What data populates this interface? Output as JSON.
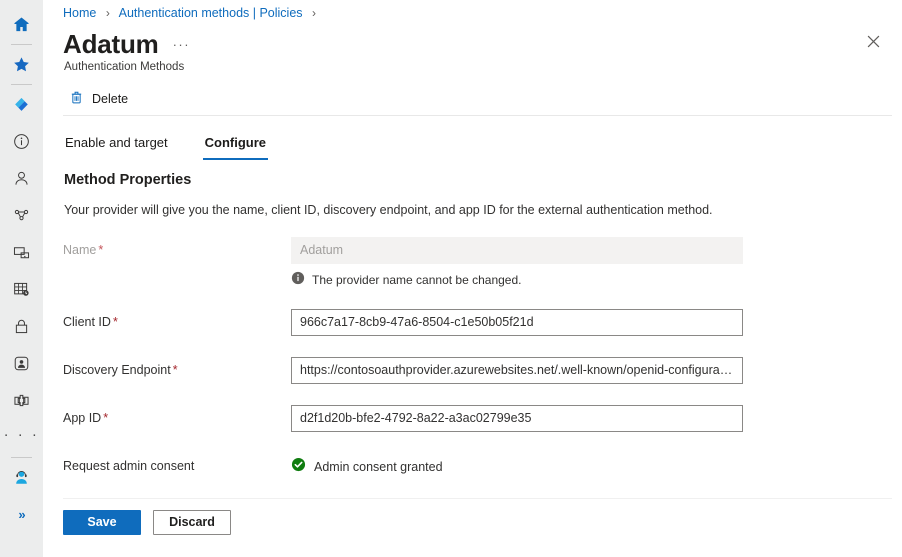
{
  "sidebar": {
    "items": [
      {
        "icon": "home-icon",
        "name": "home"
      },
      {
        "icon": "favorites-star-icon",
        "name": "favorites"
      },
      {
        "icon": "entra-diamond-icon",
        "name": "microsoft-entra"
      },
      {
        "icon": "info-circle-icon",
        "name": "overview-info"
      },
      {
        "icon": "user-person-icon",
        "name": "users"
      },
      {
        "icon": "groups-icon",
        "name": "groups"
      },
      {
        "icon": "devices-icon",
        "name": "devices"
      },
      {
        "icon": "applications-grid-icon",
        "name": "applications"
      },
      {
        "icon": "lock-icon",
        "name": "protection"
      },
      {
        "icon": "identity-governance-icon",
        "name": "identity-governance"
      },
      {
        "icon": "puzzle-icon",
        "name": "external-identities"
      },
      {
        "icon": "more-ellipsis-icon",
        "name": "show-more"
      },
      {
        "icon": "support-agent-icon",
        "name": "help-and-support"
      },
      {
        "icon": "expand-chevrons-icon",
        "name": "expand-sidebar"
      }
    ]
  },
  "breadcrumb": {
    "items": [
      "Home",
      "Authentication methods | Policies"
    ],
    "separator": "›"
  },
  "header": {
    "title": "Adatum",
    "ellipsis": "···",
    "subtitle": "Authentication Methods",
    "close_icon": "close-icon"
  },
  "commandbar": {
    "delete_label": "Delete",
    "delete_icon": "trash-icon"
  },
  "tabs": [
    {
      "label": "Enable and target",
      "active": false
    },
    {
      "label": "Configure",
      "active": true
    }
  ],
  "main": {
    "section_title": "Method Properties",
    "section_description": "Your provider will give you the name, client ID, discovery endpoint, and app ID for the external authentication method.",
    "fields": [
      {
        "label": "Name",
        "required": true,
        "value": "Adatum",
        "readonly": true,
        "hint": "The provider name cannot be changed.",
        "hint_icon": "info-icon"
      },
      {
        "label": "Client ID",
        "required": true,
        "value": "966c7a17-8cb9-47a6-8504-c1e50b05f21d",
        "readonly": false
      },
      {
        "label": "Discovery Endpoint",
        "required": true,
        "value": "https://contosoauthprovider.azurewebsites.net/.well-known/openid-configurati...",
        "readonly": false
      },
      {
        "label": "App ID",
        "required": true,
        "value": "d2f1d20b-bfe2-4792-8a22-a3ac02799e35",
        "readonly": false
      }
    ],
    "consent": {
      "label": "Request admin consent",
      "status_text": "Admin consent granted",
      "status_icon": "check-circle-green-icon"
    }
  },
  "footer": {
    "save_label": "Save",
    "discard_label": "Discard"
  },
  "colors": {
    "accent": "#0f6cbd",
    "link": "#0f6cbd",
    "required_asterisk": "#a4262c",
    "success": "#107c10",
    "rail_bg": "#eceded",
    "field_border": "#8a8886",
    "readonly_bg": "#f3f2f1"
  }
}
